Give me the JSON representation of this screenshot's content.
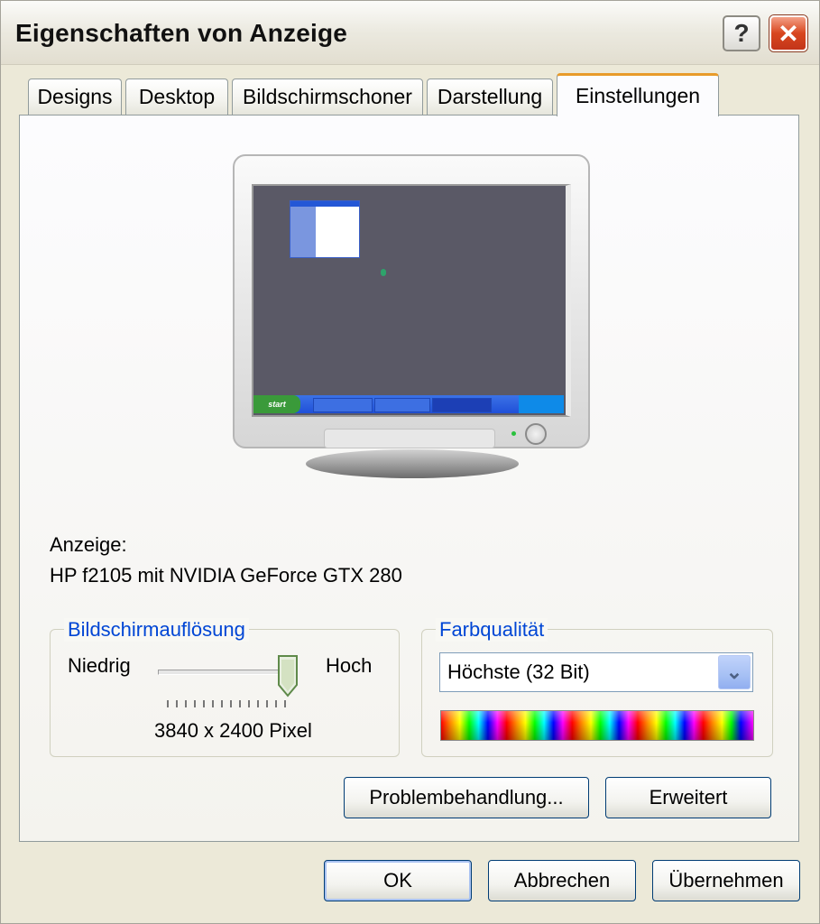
{
  "window": {
    "title": "Eigenschaften von Anzeige",
    "help_glyph": "?",
    "close_glyph": "✕"
  },
  "tabs": [
    {
      "label": "Designs"
    },
    {
      "label": "Desktop"
    },
    {
      "label": "Bildschirmschoner"
    },
    {
      "label": "Darstellung"
    },
    {
      "label": "Einstellungen",
      "active": true
    }
  ],
  "display": {
    "label": "Anzeige:",
    "device": "HP f2105 mit NVIDIA GeForce GTX 280"
  },
  "resolution": {
    "legend": "Bildschirmauflösung",
    "low": "Niedrig",
    "high": "Hoch",
    "value": "3840 x 2400 Pixel",
    "slider_level": 1.0
  },
  "color": {
    "legend": "Farbqualität",
    "selected": "Höchste (32 Bit)"
  },
  "buttons": {
    "troubleshoot": "Problembehandlung...",
    "advanced": "Erweitert",
    "ok": "OK",
    "cancel": "Abbrechen",
    "apply": "Übernehmen"
  },
  "colors": {
    "tab_accent": "#e89b2a",
    "legend_blue": "#0046d5",
    "title_close_red": "#d8461e"
  }
}
